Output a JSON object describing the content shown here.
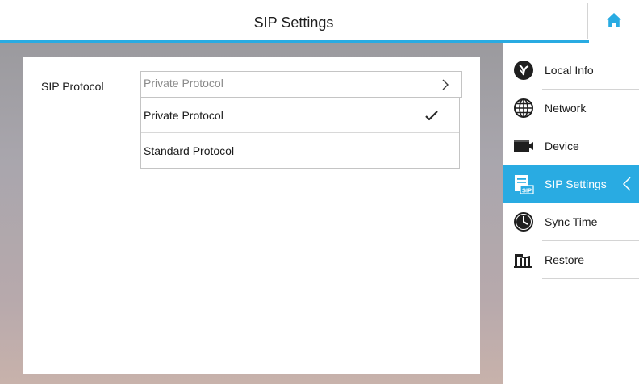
{
  "header": {
    "title": "SIP Settings",
    "home_icon": "home-icon"
  },
  "form": {
    "sip_protocol_label": "SIP Protocol",
    "sip_protocol_value": "Private Protocol",
    "options": [
      {
        "label": "Private Protocol",
        "selected": true
      },
      {
        "label": "Standard Protocol",
        "selected": false
      }
    ]
  },
  "sidebar": {
    "items": [
      {
        "label": "Local Info",
        "icon": "local-info-icon",
        "active": false
      },
      {
        "label": "Network",
        "icon": "globe-icon",
        "active": false
      },
      {
        "label": "Device",
        "icon": "device-icon",
        "active": false
      },
      {
        "label": "SIP Settings",
        "icon": "sip-icon",
        "active": true
      },
      {
        "label": "Sync Time",
        "icon": "clock-icon",
        "active": false
      },
      {
        "label": "Restore",
        "icon": "restore-icon",
        "active": false
      }
    ]
  },
  "colors": {
    "accent": "#29abe2",
    "text": "#1c1c1c",
    "placeholder": "#8a8a8a"
  }
}
